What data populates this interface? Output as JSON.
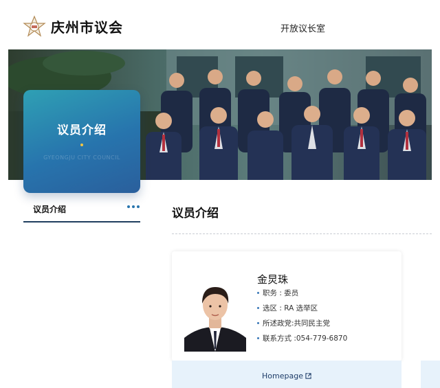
{
  "header": {
    "site_title": "庆州市议会",
    "top_link": "开放议长室",
    "emblem": "council-emblem-icon"
  },
  "hero": {
    "card_title": "议员介绍",
    "card_subtitle": "GYEONGJU CITY COUNCIL",
    "photo": "council-members-group-photo"
  },
  "side_nav": {
    "active_label": "议员介绍",
    "more_icon": "more-dots-icon"
  },
  "main": {
    "section_title": "议员介绍",
    "member": {
      "name": "金炅珠",
      "facts": [
        {
          "text": "职务 : 委员"
        },
        {
          "text": "选区 : RA 选举区"
        },
        {
          "text": "所述政党:共同民主党"
        },
        {
          "text": "联系方式 :054-779-6870"
        }
      ],
      "homepage_label": "Homepage",
      "homepage_icon": "external-link-icon"
    }
  },
  "colors": {
    "card_gradient_start": "#2fa0b4",
    "card_gradient_end": "#2a5f9c",
    "nav_underline": "#1d3d5e",
    "homepage_bar": "#e7f2fb",
    "accent_dot": "#f4c542"
  }
}
